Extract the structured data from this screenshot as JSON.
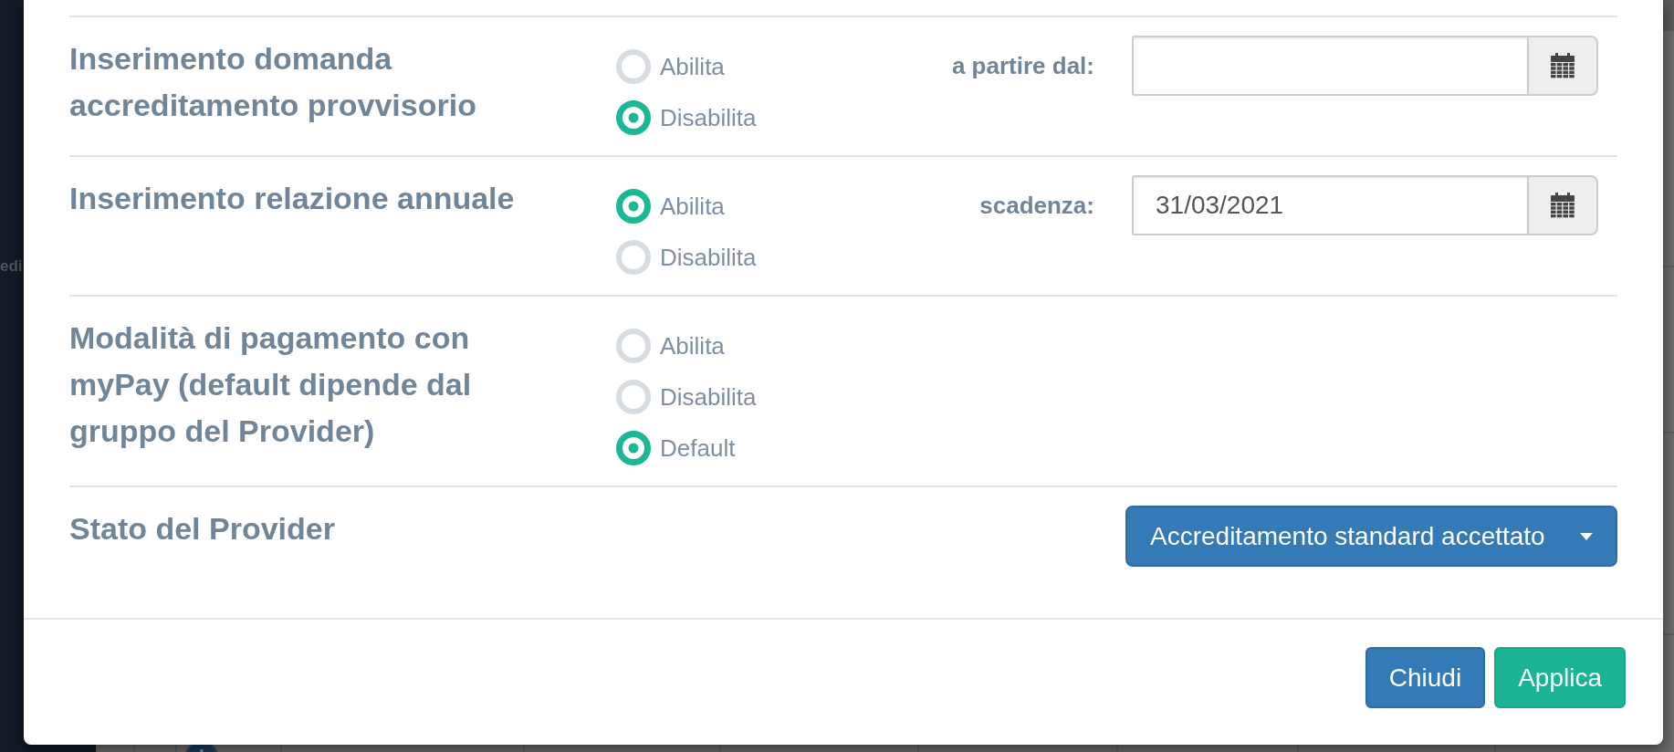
{
  "background_page": {
    "sidebar_text": "edi"
  },
  "settings": [
    {
      "label": "Inserimento domanda accreditamento provvisorio",
      "options": [
        {
          "label": "Abilita",
          "selected": false
        },
        {
          "label": "Disabilita",
          "selected": true
        }
      ],
      "date_field": {
        "label": "a partire dal:"
      }
    },
    {
      "label": "Inserimento relazione annuale",
      "options": [
        {
          "label": "Abilita",
          "selected": true
        },
        {
          "label": "Disabilita",
          "selected": false
        }
      ],
      "date_field": {
        "label": "scadenza:",
        "value": "31/03/2021"
      }
    },
    {
      "label": "Modalità di pagamento con myPay (default dipende dal gruppo del Provider)",
      "options": [
        {
          "label": "Abilita",
          "selected": false
        },
        {
          "label": "Disabilita",
          "selected": false
        },
        {
          "label": "Default",
          "selected": true
        }
      ]
    },
    {
      "label": "Stato del Provider",
      "dropdown": {
        "value": "Accreditamento standard accettato"
      }
    }
  ],
  "buttons": [
    {
      "label": "Chiudi",
      "kind": "primary"
    },
    {
      "label": "Applica",
      "kind": "success"
    }
  ]
}
